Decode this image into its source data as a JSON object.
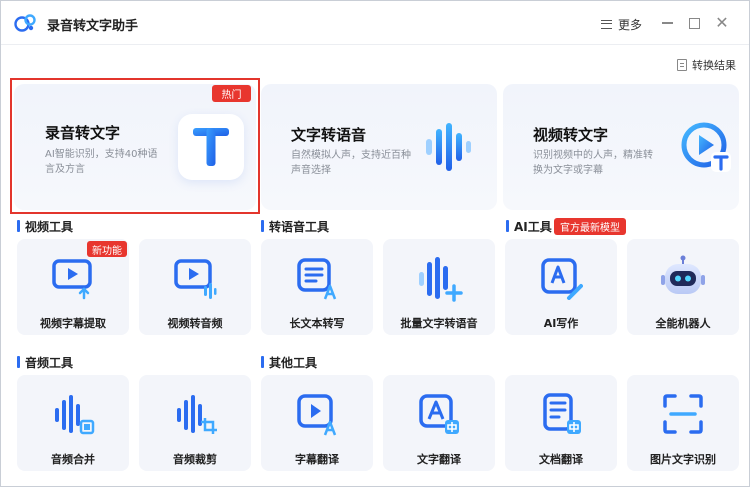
{
  "app": {
    "title": "录音转文字助手"
  },
  "window_controls": {
    "more_label": "更多",
    "close_glyph": "✕"
  },
  "results": {
    "label": "转换结果"
  },
  "features": [
    {
      "title": "录音转文字",
      "desc": "AI智能识别，支持40种语言及方言",
      "badge": "热门",
      "icon": "t-letter-icon"
    },
    {
      "title": "文字转语音",
      "desc": "自然模拟人声，支持近百种声音选择",
      "icon": "sound-wave-icon"
    },
    {
      "title": "视频转文字",
      "desc": "识别视频中的人声，精准转换为文字或字幕",
      "icon": "play-text-icon"
    }
  ],
  "sections": {
    "video": {
      "label": "视频工具"
    },
    "speech": {
      "label": "转语音工具"
    },
    "ai": {
      "label": "AI工具",
      "badge": "官方最新模型"
    },
    "audio": {
      "label": "音频工具"
    },
    "other": {
      "label": "其他工具"
    }
  },
  "tools_row1": [
    {
      "label": "视频字幕提取",
      "badge": "新功能",
      "icon": "subtitle-extract-icon"
    },
    {
      "label": "视频转音频",
      "icon": "video-to-audio-icon"
    },
    {
      "label": "长文本转写",
      "icon": "long-text-icon"
    },
    {
      "label": "批量文字转语音",
      "icon": "batch-tts-icon"
    },
    {
      "label": "AI写作",
      "icon": "ai-writing-icon"
    },
    {
      "label": "全能机器人",
      "icon": "robot-icon"
    }
  ],
  "tools_row2": [
    {
      "label": "音频合并",
      "icon": "audio-merge-icon"
    },
    {
      "label": "音频裁剪",
      "icon": "audio-crop-icon"
    },
    {
      "label": "字幕翻译",
      "icon": "subtitle-translate-icon"
    },
    {
      "label": "文字翻译",
      "icon": "text-translate-icon"
    },
    {
      "label": "文档翻译",
      "icon": "doc-translate-icon"
    },
    {
      "label": "图片文字识别",
      "icon": "image-ocr-icon"
    }
  ],
  "colors": {
    "accent": "#2b6cf0",
    "badge": "#e8362e",
    "highlight": "#e3352c"
  }
}
